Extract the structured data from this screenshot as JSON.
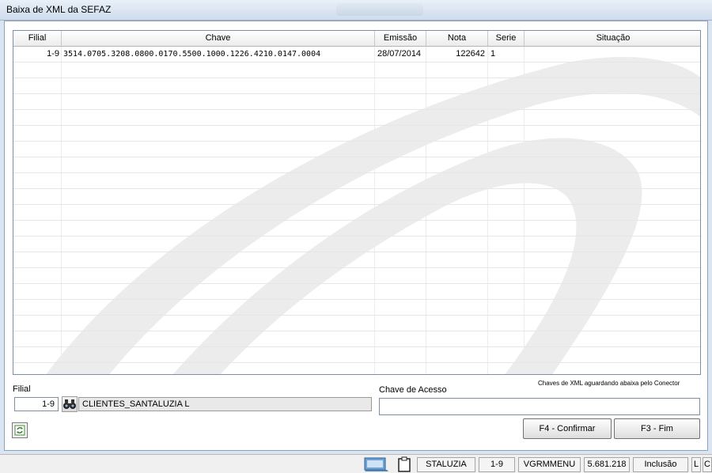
{
  "window": {
    "title": "Baixa de XML da SEFAZ"
  },
  "grid": {
    "columns": {
      "filial": "Filial",
      "chave": "Chave",
      "emissao": "Emissão",
      "nota": "Nota",
      "serie": "Serie",
      "situacao": "Situação"
    },
    "rows": [
      {
        "filial": "1-9",
        "chave": "3514.0705.3208.0800.0170.5500.1000.1226.4210.0147.0004",
        "emissao": "28/07/2014",
        "nota": "122642",
        "serie": "1",
        "situacao": ""
      }
    ]
  },
  "form": {
    "filial_label": "Filial",
    "filial_value": "1-9",
    "client_name": "CLIENTES_SANTALUZIA L",
    "chave_label": "Chave de Acesso",
    "chave_note": "Chaves de XML aguardando abaixa pelo Conector",
    "chave_value": ""
  },
  "buttons": {
    "confirm": "F4 - Confirmar",
    "exit": "F3 - Fim"
  },
  "statusbar": {
    "user": "STALUZIA",
    "filial": "1-9",
    "program": "VGRMMENU",
    "version": "5.681.218",
    "mode": "Inclusão",
    "flag1": "L",
    "flag2": "C"
  },
  "icons": {
    "search": "binoculars-icon",
    "refresh": "refresh-icon",
    "network": "network-icon",
    "clipboard": "clipboard-icon"
  }
}
